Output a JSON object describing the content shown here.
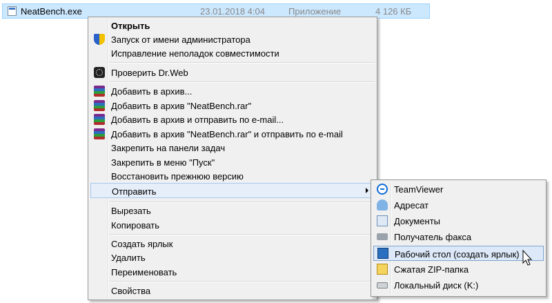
{
  "file": {
    "name": "NeatBench.exe",
    "date": "23.01.2018 4:04",
    "type": "Приложение",
    "size": "4 126 КБ"
  },
  "context_menu": {
    "items": [
      {
        "label": "Открыть",
        "icon": "none",
        "bold": true
      },
      {
        "label": "Запуск от имени администратора",
        "icon": "uac-shield-icon"
      },
      {
        "label": "Исправление неполадок совместимости",
        "icon": "none"
      },
      {
        "label": "Проверить Dr.Web",
        "icon": "drweb-icon"
      },
      {
        "label": "Добавить в архив...",
        "icon": "winrar-icon"
      },
      {
        "label": "Добавить в архив \"NeatBench.rar\"",
        "icon": "winrar-icon"
      },
      {
        "label": "Добавить в архив и отправить по e-mail...",
        "icon": "winrar-icon"
      },
      {
        "label": "Добавить в архив \"NeatBench.rar\" и отправить по e-mail",
        "icon": "winrar-icon"
      },
      {
        "label": "Закрепить на панели задач",
        "icon": "none"
      },
      {
        "label": "Закрепить в меню \"Пуск\"",
        "icon": "none"
      },
      {
        "label": "Восстановить прежнюю версию",
        "icon": "none"
      },
      {
        "label": "Отправить",
        "icon": "none",
        "submenu": true
      },
      {
        "label": "Вырезать",
        "icon": "none"
      },
      {
        "label": "Копировать",
        "icon": "none"
      },
      {
        "label": "Создать ярлык",
        "icon": "none"
      },
      {
        "label": "Удалить",
        "icon": "none"
      },
      {
        "label": "Переименовать",
        "icon": "none"
      },
      {
        "label": "Свойства",
        "icon": "none"
      }
    ]
  },
  "send_to_menu": {
    "items": [
      {
        "label": "TeamViewer",
        "icon": "teamviewer-icon"
      },
      {
        "label": "Адресат",
        "icon": "contact-icon"
      },
      {
        "label": "Документы",
        "icon": "documents-icon"
      },
      {
        "label": "Получатель факса",
        "icon": "fax-icon"
      },
      {
        "label": "Рабочий стол (создать ярлык)",
        "icon": "desktop-icon"
      },
      {
        "label": "Сжатая ZIP-папка",
        "icon": "zip-folder-icon"
      },
      {
        "label": "Локальный диск (K:)",
        "icon": "local-disk-icon"
      }
    ]
  },
  "colors": {
    "selection": "#cce8ff",
    "menu_bg": "#f0f0f0",
    "hover": "#dde9f8"
  }
}
